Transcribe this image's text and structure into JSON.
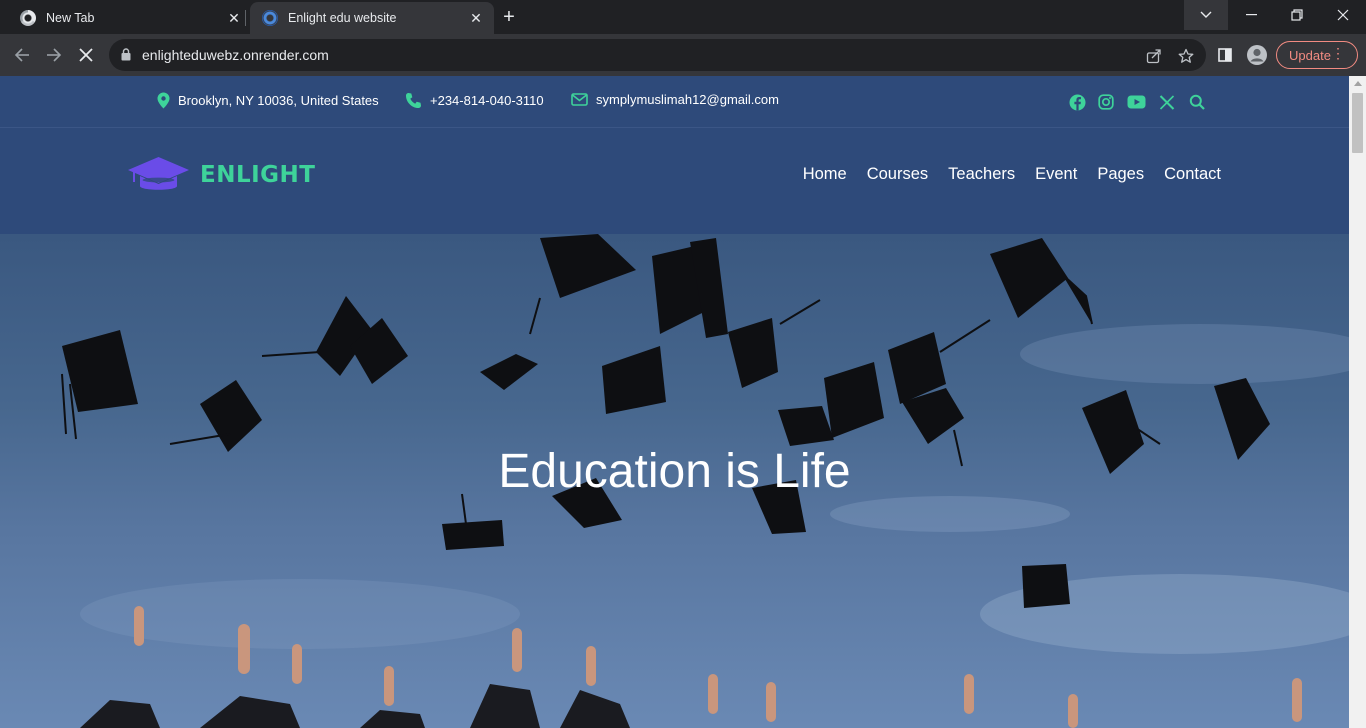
{
  "browser": {
    "tabs": [
      {
        "title": "New Tab",
        "active": false
      },
      {
        "title": "Enlight edu website",
        "active": true
      }
    ],
    "url": "enlighteduwebz.onrender.com",
    "update_label": "Update",
    "accent_update": "#f28b82"
  },
  "site": {
    "topbar": {
      "address": "Brooklyn, NY 10036, United States",
      "phone": "+234-814-040-3110",
      "email": "symplymuslimah12@gmail.com",
      "social_icons": [
        "facebook-icon",
        "instagram-icon",
        "youtube-icon",
        "x-icon",
        "search-icon"
      ],
      "icon_color": "#3ed39a"
    },
    "brand": {
      "name": "ENLIGHT",
      "logo_icon": "graduation-cap-icon",
      "logo_color": "#6a4ce8",
      "text_color": "#3ed39a"
    },
    "nav": [
      "Home",
      "Courses",
      "Teachers",
      "Event",
      "Pages",
      "Contact"
    ],
    "hero": {
      "title": "Education is Life"
    },
    "header_bg": "#2e4a7a"
  }
}
